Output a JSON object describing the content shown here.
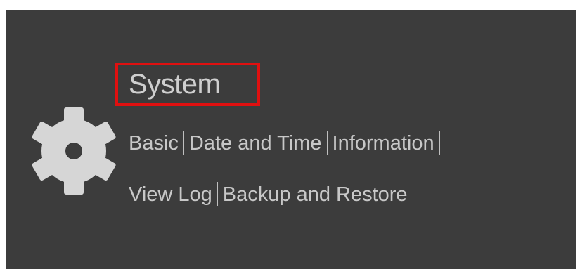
{
  "section": {
    "icon": "gear-icon",
    "title": "System",
    "highlight_color": "#e01010"
  },
  "links": {
    "basic": "Basic",
    "date_time": "Date and Time",
    "information": "Information",
    "view_log": "View Log",
    "backup_restore": "Backup and Restore"
  }
}
